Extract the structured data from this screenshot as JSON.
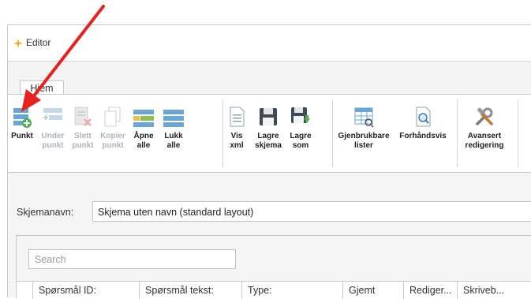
{
  "window": {
    "title": "Editor"
  },
  "tabs": [
    {
      "label": "Hjem"
    }
  ],
  "ribbon": {
    "buttons": [
      {
        "label_1": "Punkt",
        "label_2": "",
        "icon": "add-item-icon",
        "enabled": true
      },
      {
        "label_1": "Under",
        "label_2": "punkt",
        "icon": "add-subitem-icon",
        "enabled": false
      },
      {
        "label_1": "Slett",
        "label_2": "punkt",
        "icon": "delete-item-icon",
        "enabled": false
      },
      {
        "label_1": "Kopier",
        "label_2": "punkt",
        "icon": "copy-icon",
        "enabled": false
      },
      {
        "label_1": "Åpne",
        "label_2": "alle",
        "icon": "expand-all-icon",
        "enabled": true
      },
      {
        "label_1": "Lukk",
        "label_2": "alle",
        "icon": "collapse-all-icon",
        "enabled": true
      },
      {
        "label_1": "Vis",
        "label_2": "xml",
        "icon": "document-icon",
        "enabled": true
      },
      {
        "label_1": "Lagre",
        "label_2": "skjema",
        "icon": "save-icon",
        "enabled": true
      },
      {
        "label_1": "Lagre",
        "label_2": "som",
        "icon": "save-as-icon",
        "enabled": true
      },
      {
        "label_1": "Gjenbrukbare",
        "label_2": "lister",
        "icon": "table-icon",
        "enabled": true
      },
      {
        "label_1": "Forhåndsvis",
        "label_2": "",
        "icon": "preview-icon",
        "enabled": true
      },
      {
        "label_1": "Avansert",
        "label_2": "redigering",
        "icon": "tools-icon",
        "enabled": true
      }
    ]
  },
  "form": {
    "schema_label": "Skjemanavn:",
    "schema_value": "Skjema uten navn (standard layout)",
    "search_placeholder": "Search"
  },
  "table": {
    "columns": [
      "Spørsmål ID:",
      "Spørsmål tekst:",
      "Type:",
      "Gjemt",
      "Rediger...",
      "Skriveb..."
    ]
  },
  "colors": {
    "annotation_arrow": "#e8201e",
    "accent_orange": "#f5a623"
  }
}
